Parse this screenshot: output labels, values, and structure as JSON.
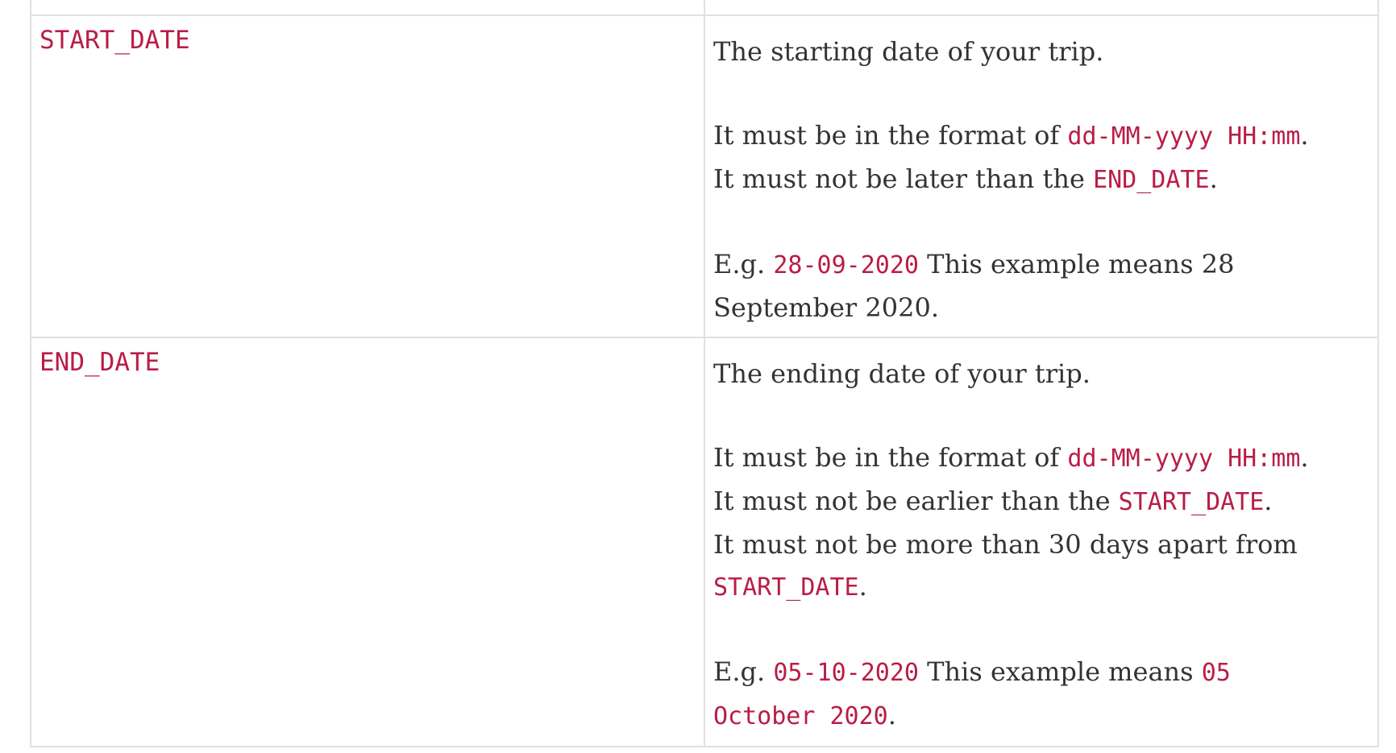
{
  "rows": [
    {
      "name": "START_DATE",
      "intro": "The starting date of your trip.",
      "format_prefix": "It must be in the format of ",
      "format_code": "dd-MM-yyyy HH:mm",
      "format_suffix": ".",
      "rule1_prefix": "It must not be later than the ",
      "rule1_code": "END_DATE",
      "rule1_suffix": ".",
      "example_prefix": "E.g. ",
      "example_code": "28-09-2020",
      "example_text": " This example means 28 September 2020."
    },
    {
      "name": "END_DATE",
      "intro": "The ending date of your trip.",
      "format_prefix": "It must be in the format of ",
      "format_code": "dd-MM-yyyy HH:mm",
      "format_suffix": ".",
      "rule1_prefix": "It must not be earlier than the ",
      "rule1_code": "START_DATE",
      "rule1_suffix": ".",
      "rule2_prefix": "It must not be more than 30 days apart from ",
      "rule2_code": "START_DATE",
      "rule2_suffix": ".",
      "example_prefix": "E.g. ",
      "example_code": "05-10-2020",
      "example_text": " This example means ",
      "example_code2": "05 October 2020",
      "example_suffix": "."
    }
  ],
  "colors": {
    "code": "#b91d47",
    "text": "#333333",
    "border": "#e0e0e0"
  }
}
